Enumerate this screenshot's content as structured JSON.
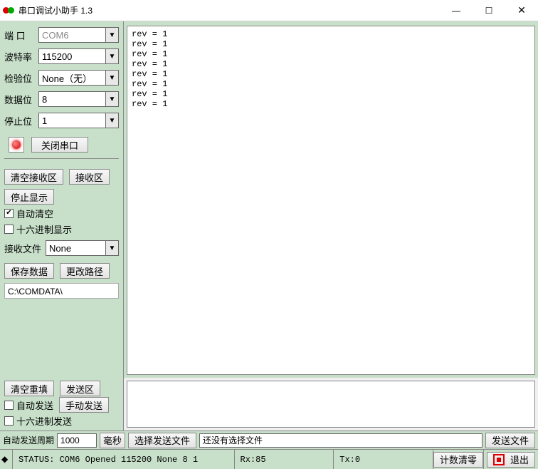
{
  "window": {
    "title": "串口调试小助手 1.3"
  },
  "config": {
    "port_label": "端  口",
    "port_value": "COM6",
    "baud_label": "波特率",
    "baud_value": "115200",
    "parity_label": "检验位",
    "parity_value": "None（无）",
    "data_label": "数据位",
    "data_value": "8",
    "stop_label": "停止位",
    "stop_value": "1",
    "close_port_btn": "关闭串口"
  },
  "rx": {
    "clear_rx_btn": "清空接收区",
    "rx_area_btn": "接收区",
    "stop_display_btn": "停止显示",
    "auto_clear_chk": "自动清空",
    "auto_clear_checked": true,
    "hex_display_chk": "十六进制显示",
    "hex_display_checked": false,
    "rx_file_label": "接收文件",
    "rx_file_value": "None",
    "save_data_btn": "保存数据",
    "change_path_btn": "更改路径",
    "path": "C:\\COMDATA\\"
  },
  "rx_content": "rev = 1\nrev = 1\nrev = 1\nrev = 1\nrev = 1\nrev = 1\nrev = 1\nrev = 1",
  "tx": {
    "clear_refill_btn": "清空重填",
    "tx_area_btn": "发送区",
    "auto_send_chk": "自动发送",
    "auto_send_checked": false,
    "manual_send_btn": "手动发送",
    "hex_send_chk": "十六进制发送",
    "hex_send_checked": false,
    "period_label": "自动发送周期",
    "period_value": "1000",
    "period_unit": "毫秒",
    "choose_file_btn": "选择发送文件",
    "no_file_text": "还没有选择文件",
    "send_file_btn": "发送文件"
  },
  "status": {
    "text": "STATUS: COM6 Opened 115200 None  8 1",
    "rx_count": "Rx:85",
    "tx_count": "Tx:0",
    "clear_count_btn": "计数清零",
    "exit_btn": "退出"
  }
}
